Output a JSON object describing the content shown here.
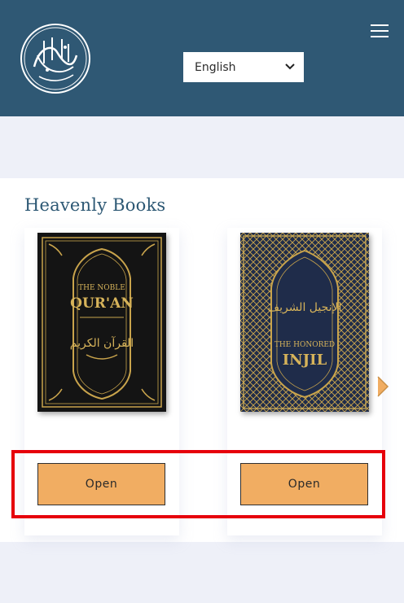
{
  "header": {
    "logo_icon": "calligraphy-logo",
    "language": {
      "selected": "English"
    },
    "menu_icon": "hamburger-menu-icon"
  },
  "section": {
    "title": "Heavenly Books"
  },
  "books": [
    {
      "cover_small": "THE NOBLE",
      "cover_large": "QUR'AN",
      "cover_arabic": "القرآن الكريم",
      "button": "Open"
    },
    {
      "cover_small": "THE HONORED",
      "cover_large": "INJIL",
      "cover_arabic": "الإنجيل الشريف",
      "button": "Open"
    }
  ],
  "colors": {
    "header_bg": "#2f5874",
    "accent": "#f1ad62",
    "title": "#2d5874",
    "highlight": "#e6000b"
  }
}
